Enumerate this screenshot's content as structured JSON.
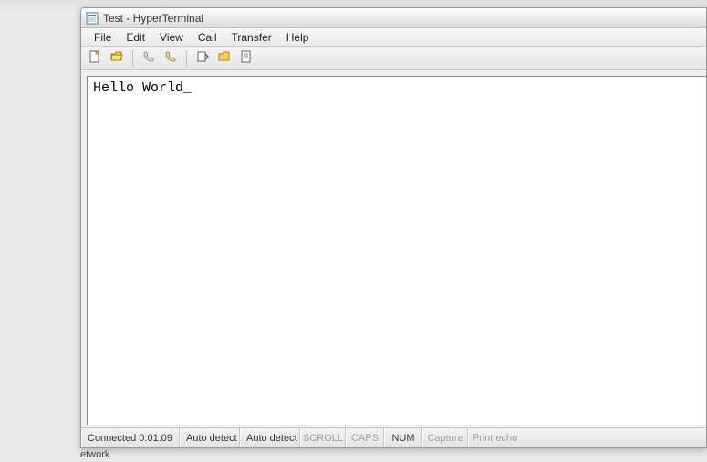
{
  "titlebar": {
    "title": "Test - HyperTerminal"
  },
  "menubar": {
    "file": "File",
    "edit": "Edit",
    "view": "View",
    "call": "Call",
    "transfer": "Transfer",
    "help": "Help"
  },
  "toolbar": {
    "new": "new-file-icon",
    "open": "open-folder-icon",
    "connect": "connect-phone-icon",
    "disconnect": "disconnect-phone-icon",
    "send": "send-icon",
    "receive": "receive-icon",
    "properties": "properties-icon"
  },
  "terminal": {
    "content": "Hello World",
    "cursor": "_"
  },
  "statusbar": {
    "connected_label": "Connected",
    "connected_time": "0:01:09",
    "autodetect1": "Auto detect",
    "autodetect2": "Auto detect",
    "scroll": "SCROLL",
    "caps": "CAPS",
    "num": "NUM",
    "capture": "Capture",
    "printecho": "Print echo"
  },
  "fragment": {
    "text": "etwork"
  }
}
